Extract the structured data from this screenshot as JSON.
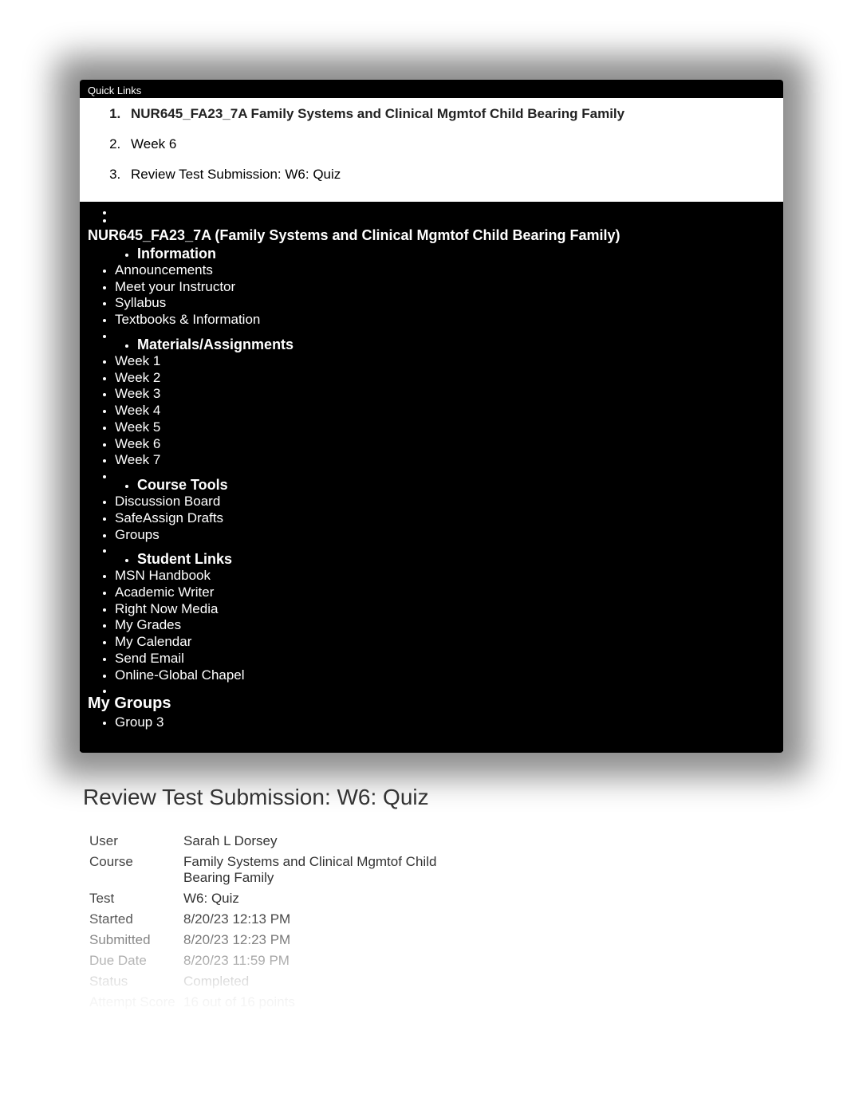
{
  "quick_links": "Quick Links",
  "breadcrumb": {
    "course_link": "NUR645_FA23_7A Family Systems and Clinical Mgmtof Child Bearing Family",
    "week": "Week 6",
    "current": "Review Test Submission: W6: Quiz"
  },
  "course_heading": "NUR645_FA23_7A (Family Systems and Clinical Mgmtof Child Bearing Family)",
  "sections": {
    "information": {
      "heading": "Information",
      "items": [
        "Announcements",
        "Meet your Instructor",
        "Syllabus",
        "Textbooks & Information"
      ]
    },
    "materials": {
      "heading": "Materials/Assignments",
      "items": [
        "Week 1",
        "Week 2",
        "Week 3",
        "Week 4",
        "Week 5",
        "Week 6",
        "Week 7"
      ]
    },
    "course_tools": {
      "heading": "Course Tools",
      "items": [
        "Discussion Board",
        "SafeAssign Drafts",
        "Groups"
      ]
    },
    "student_links": {
      "heading": "Student Links",
      "items": [
        "MSN Handbook",
        "Academic Writer",
        "Right Now Media",
        "My Grades",
        "My Calendar",
        "Send Email",
        "Online-Global Chapel"
      ]
    }
  },
  "my_groups": {
    "heading": "My Groups",
    "items": [
      "Group 3"
    ]
  },
  "page_title": "Review Test Submission: W6: Quiz",
  "details": {
    "user_label": "User",
    "user_value": "Sarah L Dorsey",
    "course_label": "Course",
    "course_value": "Family Systems and Clinical Mgmtof Child Bearing Family",
    "test_label": "Test",
    "test_value": "W6: Quiz",
    "started_label": "Started",
    "started_value": "8/20/23 12:13 PM",
    "submitted_label": "Submitted",
    "submitted_value": "8/20/23 12:23 PM",
    "due_label": "Due Date",
    "due_value": "8/20/23 11:59 PM",
    "status_label": "Status",
    "status_value": "Completed",
    "score_label": "Attempt Score",
    "score_value": "16 out of 16 points"
  }
}
